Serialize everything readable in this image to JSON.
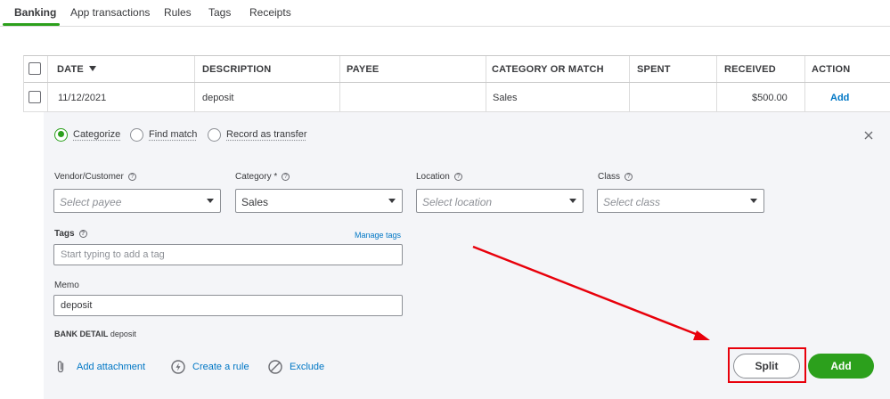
{
  "tabs": [
    {
      "label": "Banking",
      "active": true
    },
    {
      "label": "App transactions"
    },
    {
      "label": "Rules"
    },
    {
      "label": "Tags"
    },
    {
      "label": "Receipts"
    }
  ],
  "table": {
    "headers": [
      "DATE",
      "DESCRIPTION",
      "PAYEE",
      "CATEGORY OR MATCH",
      "SPENT",
      "RECEIVED",
      "ACTION"
    ],
    "row": {
      "date": "11/12/2021",
      "description": "deposit",
      "payee": "",
      "category": "Sales",
      "spent": "",
      "received": "$500.00",
      "action": "Add"
    }
  },
  "panel": {
    "modes": [
      {
        "label": "Categorize",
        "selected": true
      },
      {
        "label": "Find match",
        "selected": false
      },
      {
        "label": "Record as transfer",
        "selected": false
      }
    ],
    "fields": {
      "vendor": {
        "label": "Vendor/Customer",
        "placeholder": "Select payee"
      },
      "category": {
        "label": "Category *",
        "value": "Sales"
      },
      "location": {
        "label": "Location",
        "placeholder": "Select location"
      },
      "class": {
        "label": "Class",
        "placeholder": "Select class"
      },
      "tags": {
        "label": "Tags",
        "placeholder": "Start typing to add a tag",
        "manage": "Manage tags"
      },
      "memo": {
        "label": "Memo",
        "value": "deposit"
      }
    },
    "bank_detail": {
      "label": "BANK DETAIL",
      "value": "deposit"
    },
    "links": {
      "attachment": "Add attachment",
      "rule": "Create a rule",
      "exclude": "Exclude"
    },
    "buttons": {
      "split": "Split",
      "add": "Add"
    }
  },
  "colors": {
    "brand_green": "#2ca01c",
    "link_blue": "#0077c5",
    "annotation_red": "#e8000b",
    "panel_bg": "#f4f5f8"
  },
  "icons": [
    "paperclip-icon",
    "lightning-icon",
    "exclude-icon",
    "close-icon",
    "info-icon",
    "sort-down-icon",
    "chevron-down-icon"
  ]
}
